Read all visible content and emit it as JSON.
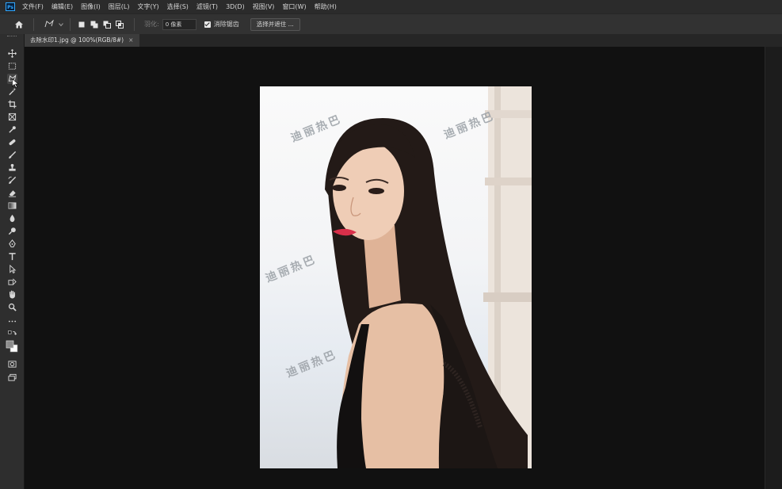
{
  "app": {
    "logo_text": "Ps"
  },
  "menu": [
    "文件(F)",
    "编辑(E)",
    "图像(I)",
    "图层(L)",
    "文字(Y)",
    "选择(S)",
    "滤镜(T)",
    "3D(D)",
    "视图(V)",
    "窗口(W)",
    "帮助(H)"
  ],
  "options": {
    "feather_label": "羽化:",
    "feather_value": "0 像素",
    "antialias_label": "消除锯齿",
    "select_mask_label": "选择并遮住 ..."
  },
  "document": {
    "tab_title": "去除水印1.jpg @ 100%(RGB/8#)",
    "close_glyph": "×"
  },
  "watermark_text": "迪丽热巴",
  "tools": [
    "move-tool",
    "marquee-tool",
    "lasso-tool",
    "magic-wand-tool",
    "crop-tool",
    "frame-tool",
    "eyedropper-tool",
    "healing-brush-tool",
    "brush-tool",
    "clone-stamp-tool",
    "history-brush-tool",
    "eraser-tool",
    "gradient-tool",
    "blur-tool",
    "dodge-tool",
    "pen-tool",
    "type-tool",
    "path-selection-tool",
    "shape-tool",
    "hand-tool",
    "zoom-tool",
    "more-tools",
    "swap-colors-icon",
    "foreground-background-colors",
    "quick-mask-icon",
    "screen-mode-icon"
  ],
  "colors": {
    "accent": "#31a8ff",
    "menubar": "#2b2b2b",
    "canvas": "#111111"
  }
}
